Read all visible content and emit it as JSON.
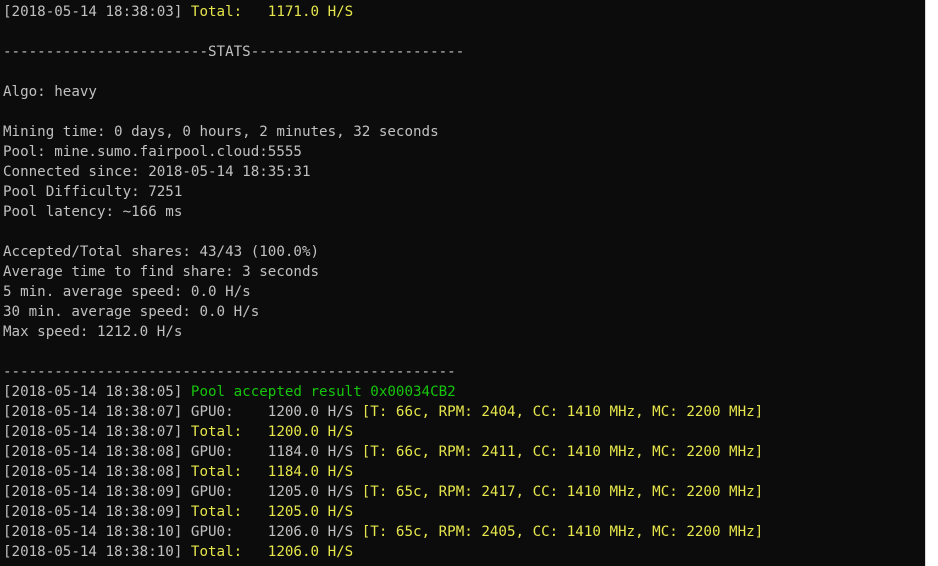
{
  "colors": {
    "background": "#0c0c0c",
    "text": "#c0c0c0",
    "yellow": "#e6e64c",
    "green": "#16c60c"
  },
  "lines": [
    {
      "segments": [
        {
          "text": "[2018-05-14 18:38:03] ",
          "color": "text"
        },
        {
          "text": "Total:   1171.0 H/S",
          "color": "yellow"
        }
      ]
    },
    {
      "segments": []
    },
    {
      "segments": [
        {
          "text": "------------------------STATS-------------------------",
          "color": "text"
        }
      ]
    },
    {
      "segments": []
    },
    {
      "segments": [
        {
          "text": "Algo: heavy",
          "color": "text"
        }
      ]
    },
    {
      "segments": []
    },
    {
      "segments": [
        {
          "text": "Mining time: 0 days, 0 hours, 2 minutes, 32 seconds",
          "color": "text"
        }
      ]
    },
    {
      "segments": [
        {
          "text": "Pool: mine.sumo.fairpool.cloud:5555",
          "color": "text"
        }
      ]
    },
    {
      "segments": [
        {
          "text": "Connected since: 2018-05-14 18:35:31",
          "color": "text"
        }
      ]
    },
    {
      "segments": [
        {
          "text": "Pool Difficulty: 7251",
          "color": "text"
        }
      ]
    },
    {
      "segments": [
        {
          "text": "Pool latency: ~166 ms",
          "color": "text"
        }
      ]
    },
    {
      "segments": []
    },
    {
      "segments": [
        {
          "text": "Accepted/Total shares: 43/43 (100.0%)",
          "color": "text"
        }
      ]
    },
    {
      "segments": [
        {
          "text": "Average time to find share: 3 seconds",
          "color": "text"
        }
      ]
    },
    {
      "segments": [
        {
          "text": "5 min. average speed: 0.0 H/s",
          "color": "text"
        }
      ]
    },
    {
      "segments": [
        {
          "text": "30 min. average speed: 0.0 H/s",
          "color": "text"
        }
      ]
    },
    {
      "segments": [
        {
          "text": "Max speed: 1212.0 H/s",
          "color": "text"
        }
      ]
    },
    {
      "segments": []
    },
    {
      "segments": [
        {
          "text": "-----------------------------------------------------",
          "color": "text"
        }
      ]
    },
    {
      "segments": [
        {
          "text": "[2018-05-14 18:38:05] ",
          "color": "text"
        },
        {
          "text": "Pool accepted result 0x00034CB2",
          "color": "green"
        }
      ]
    },
    {
      "segments": [
        {
          "text": "[2018-05-14 18:38:07] GPU0:    1200.0 H/S ",
          "color": "text"
        },
        {
          "text": "[T: 66c, RPM: 2404, CC: 1410 MHz, MC: 2200 MHz]",
          "color": "yellow"
        }
      ]
    },
    {
      "segments": [
        {
          "text": "[2018-05-14 18:38:07] ",
          "color": "text"
        },
        {
          "text": "Total:   1200.0 H/S",
          "color": "yellow"
        }
      ]
    },
    {
      "segments": [
        {
          "text": "[2018-05-14 18:38:08] GPU0:    1184.0 H/S ",
          "color": "text"
        },
        {
          "text": "[T: 66c, RPM: 2411, CC: 1410 MHz, MC: 2200 MHz]",
          "color": "yellow"
        }
      ]
    },
    {
      "segments": [
        {
          "text": "[2018-05-14 18:38:08] ",
          "color": "text"
        },
        {
          "text": "Total:   1184.0 H/S",
          "color": "yellow"
        }
      ]
    },
    {
      "segments": [
        {
          "text": "[2018-05-14 18:38:09] GPU0:    1205.0 H/S ",
          "color": "text"
        },
        {
          "text": "[T: 65c, RPM: 2417, CC: 1410 MHz, MC: 2200 MHz]",
          "color": "yellow"
        }
      ]
    },
    {
      "segments": [
        {
          "text": "[2018-05-14 18:38:09] ",
          "color": "text"
        },
        {
          "text": "Total:   1205.0 H/S",
          "color": "yellow"
        }
      ]
    },
    {
      "segments": [
        {
          "text": "[2018-05-14 18:38:10] GPU0:    1206.0 H/S ",
          "color": "text"
        },
        {
          "text": "[T: 65c, RPM: 2405, CC: 1410 MHz, MC: 2200 MHz]",
          "color": "yellow"
        }
      ]
    },
    {
      "segments": [
        {
          "text": "[2018-05-14 18:38:10] ",
          "color": "text"
        },
        {
          "text": "Total:   1206.0 H/S",
          "color": "yellow"
        }
      ]
    }
  ]
}
